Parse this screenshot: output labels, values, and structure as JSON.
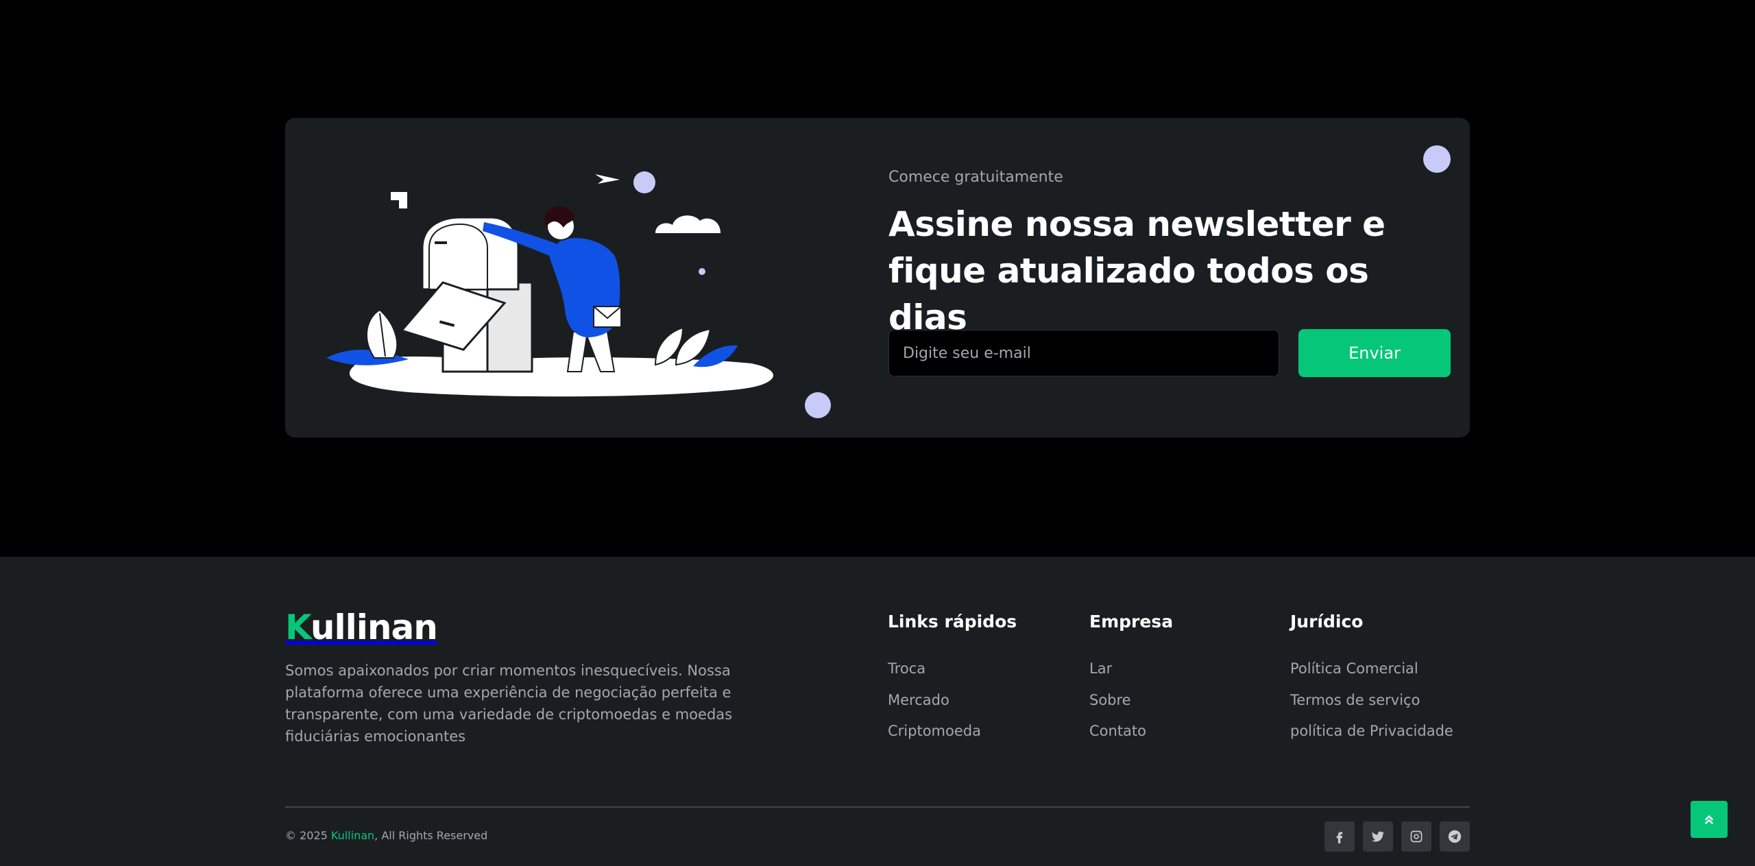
{
  "newsletter": {
    "eyebrow": "Comece gratuitamente",
    "heading": "Assine nossa newsletter e fique atualizado todos os dias",
    "email_placeholder": "Digite seu e-mail",
    "submit_label": "Enviar"
  },
  "footer": {
    "brand": {
      "logo_first": "K",
      "logo_rest": "ullinan"
    },
    "description": "Somos apaixonados por criar momentos inesquecíveis. Nossa plataforma oferece uma experiência de negociação perfeita e transparente, com uma variedade de criptomoedas e moedas fiduciárias emocionantes",
    "columns": [
      {
        "title": "Links rápidos",
        "links": [
          "Troca",
          "Mercado",
          "Criptomoeda"
        ]
      },
      {
        "title": "Empresa",
        "links": [
          "Lar",
          "Sobre",
          "Contato"
        ]
      },
      {
        "title": "Jurídico",
        "links": [
          "Política Comercial",
          "Termos de serviço",
          "política de Privacidade"
        ]
      }
    ],
    "copyright": {
      "prefix": "© 2025 ",
      "brand": "Kullinan",
      "suffix": ", All Rights Reserved"
    },
    "socials": [
      "facebook-icon",
      "twitter-icon",
      "instagram-icon",
      "telegram-icon"
    ]
  },
  "colors": {
    "accent": "#06c779",
    "card_bg": "#1b1e21",
    "page_bg": "#000000",
    "illustration_blue": "#1152e6",
    "deco_lavender": "#c8cbf7"
  }
}
